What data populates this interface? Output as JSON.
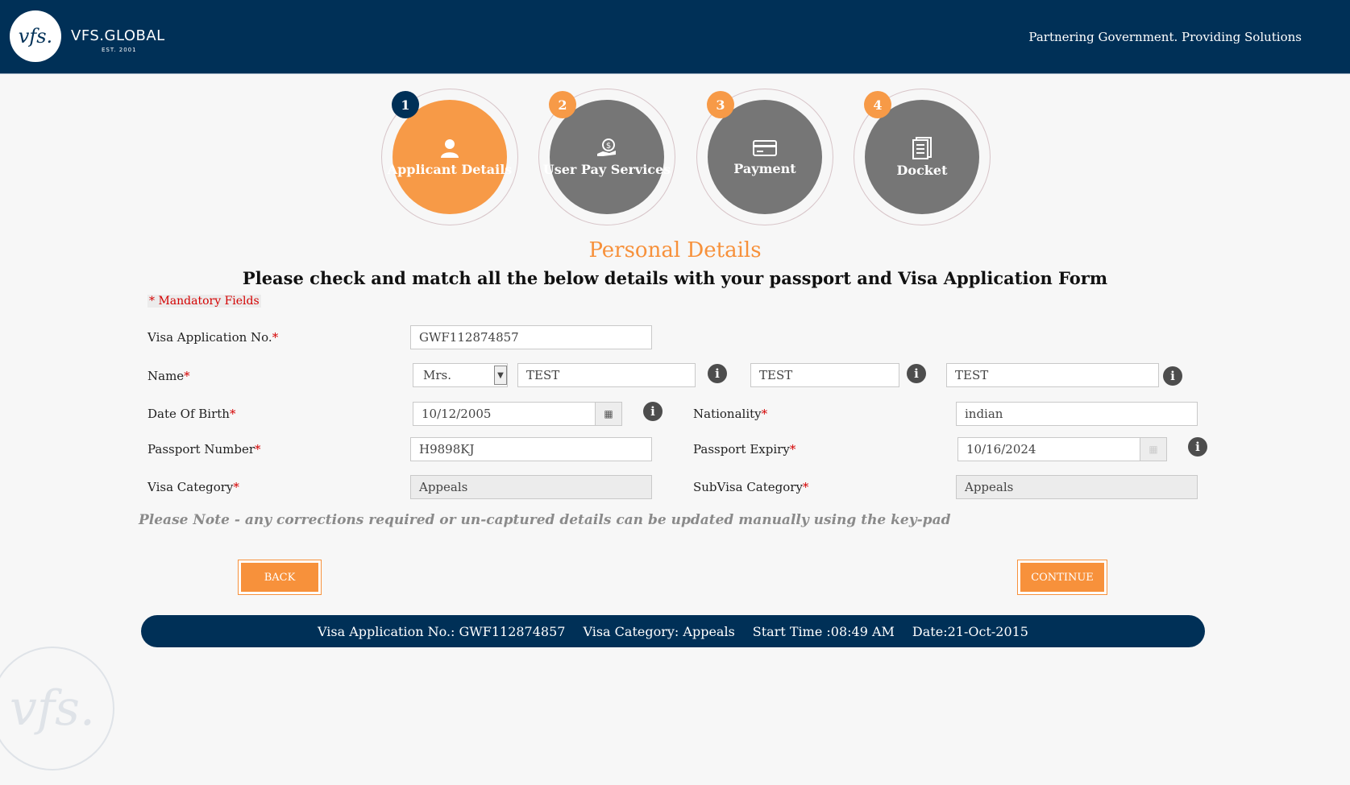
{
  "header": {
    "logo_text": "vfs.",
    "brand": "VFS.GLOBAL",
    "brand_est": "EST. 2001",
    "tagline": "Partnering Government. Providing Solutions"
  },
  "steps": [
    {
      "num": "1",
      "label": "Applicant Details",
      "icon": "person-icon",
      "active": true
    },
    {
      "num": "2",
      "label": "User Pay Services",
      "icon": "money-hand-icon",
      "active": false
    },
    {
      "num": "3",
      "label": "Payment",
      "icon": "credit-card-icon",
      "active": false
    },
    {
      "num": "4",
      "label": "Docket",
      "icon": "document-icon",
      "active": false
    }
  ],
  "page_title": "Personal Details",
  "subtitle": "Please check and match all the below details with your passport and Visa Application Form",
  "mandatory_note": "* Mandatory Fields",
  "form": {
    "visa_app_no_label": "Visa Application No.",
    "visa_app_no": "GWF112874857",
    "name_label": "Name",
    "title": "Mrs.",
    "first_name": "TEST",
    "middle_name": "TEST",
    "last_name": "TEST",
    "dob_label": "Date Of Birth",
    "dob": "10/12/2005",
    "nationality_label": "Nationality",
    "nationality": "indian",
    "passport_label": "Passport Number",
    "passport": "H9898KJ",
    "passport_expiry_label": "Passport Expiry",
    "passport_expiry": "10/16/2024",
    "visa_category_label": "Visa Category",
    "visa_category": "Appeals",
    "subvisa_label": "SubVisa Category",
    "subvisa": "Appeals",
    "required_mark": "*",
    "info_glyph": "i"
  },
  "note": "Please Note - any corrections required or un-captured details can be updated manually using the key-pad",
  "buttons": {
    "back": "BACK",
    "continue": "CONTINUE"
  },
  "footer": {
    "visa_app_no": "Visa Application No.: GWF112874857",
    "visa_category": "Visa Category: Appeals",
    "start_time": "Start Time :08:49 AM",
    "date": "Date:21-Oct-2015"
  },
  "watermark_text": "vfs.",
  "colors": {
    "navy": "#003057",
    "orange": "#f7913b",
    "step_grey": "#767676"
  }
}
